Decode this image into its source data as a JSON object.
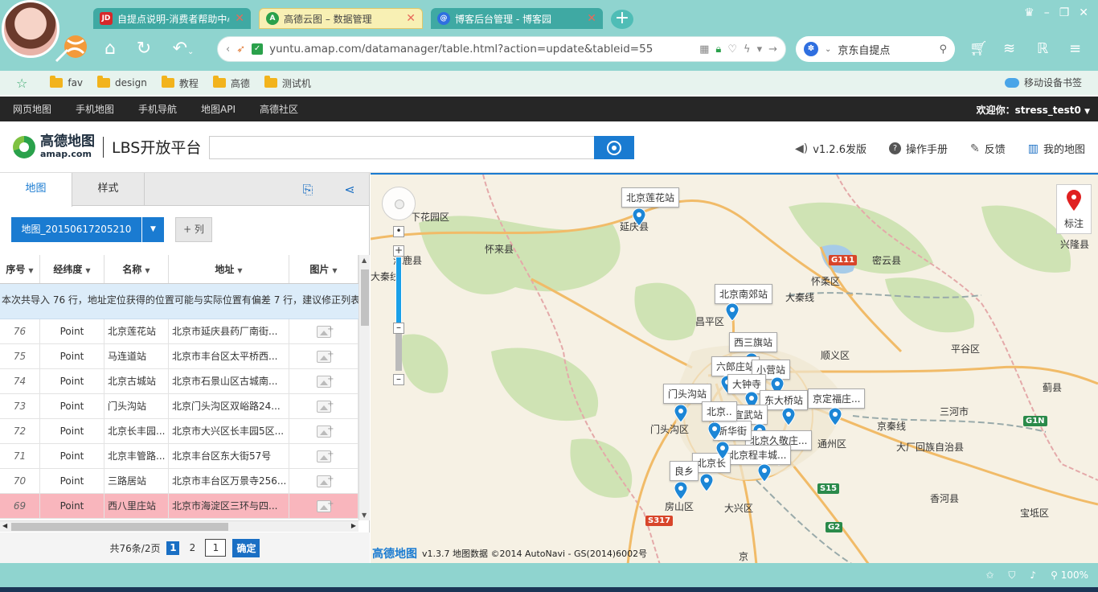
{
  "browser": {
    "tabs": [
      {
        "label": "自提点说明-消费者帮助中心",
        "favicon": "JD",
        "color": "#d7282a"
      },
      {
        "label": "高德云图 – 数据管理",
        "favicon": "A",
        "color": "#2aa14b"
      },
      {
        "label": "博客后台管理 - 博客园",
        "favicon": "@",
        "color": "#2f6fe0"
      }
    ],
    "url": "yuntu.amap.com/datamanager/table.html?action=update&tableid=55",
    "search_engine_text": "京东自提点",
    "bookmarks": [
      "fav",
      "design",
      "教程",
      "高德",
      "测试机"
    ],
    "mobile_bookmark": "移动设备书签",
    "zoom": "100%"
  },
  "sitenav": {
    "items": [
      "网页地图",
      "手机地图",
      "手机导航",
      "地图API",
      "高德社区"
    ],
    "welcome": "欢迎你：stress_test0"
  },
  "header": {
    "logo_cn": "高德地图",
    "logo_en": "amap.com",
    "lbs": "LBS开放平台",
    "search_placeholder": "",
    "links": [
      {
        "label": "v1.2.6发版",
        "icon": "speaker-icon"
      },
      {
        "label": "操作手册",
        "icon": "help-icon"
      },
      {
        "label": "反馈",
        "icon": "edit-icon"
      },
      {
        "label": "我的地图",
        "icon": "map-icon"
      }
    ]
  },
  "panel": {
    "tabs": [
      "地图",
      "样式"
    ],
    "map_select": "地图_20150617205210",
    "column_button": "+ 列",
    "columns": [
      "序号",
      "经纬度",
      "名称",
      "地址",
      "图片"
    ],
    "notice": "本次共导入 76 行，地址定位获得的位置可能与实际位置有偏差 7 行，建议修正列表",
    "rows": [
      {
        "id": "76",
        "geo": "Point",
        "name": "北京莲花站",
        "addr": "北京市延庆县药厂南街..."
      },
      {
        "id": "75",
        "geo": "Point",
        "name": "马连道站",
        "addr": "北京市丰台区太平桥西..."
      },
      {
        "id": "74",
        "geo": "Point",
        "name": "北京古城站",
        "addr": "北京市石景山区古城南..."
      },
      {
        "id": "73",
        "geo": "Point",
        "name": "门头沟站",
        "addr": "北京门头沟区双峪路24..."
      },
      {
        "id": "72",
        "geo": "Point",
        "name": "北京长丰园...",
        "addr": "北京市大兴区长丰园5区..."
      },
      {
        "id": "71",
        "geo": "Point",
        "name": "北京丰管路...",
        "addr": "北京丰台区东大街57号"
      },
      {
        "id": "70",
        "geo": "Point",
        "name": "三路居站",
        "addr": "北京市丰台区万景寺256..."
      },
      {
        "id": "69",
        "geo": "Point",
        "name": "西八里庄站",
        "addr": "北京市海淀区三环与四..."
      }
    ],
    "selected_row_index": 7,
    "pager": {
      "summary": "共76条/2页",
      "pages": [
        "1",
        "2"
      ],
      "current": "1",
      "input": "1",
      "ok": "确定"
    }
  },
  "map": {
    "places": [
      {
        "label": "下花园区"
      },
      {
        "label": "延庆县"
      },
      {
        "label": "怀来县"
      },
      {
        "label": "涿鹿县"
      },
      {
        "label": "大秦线"
      },
      {
        "label": "密云县"
      },
      {
        "label": "兴隆县"
      },
      {
        "label": "怀柔区"
      },
      {
        "label": "大秦线"
      },
      {
        "label": "昌平区"
      },
      {
        "label": "顺义区"
      },
      {
        "label": "平谷区"
      },
      {
        "label": "蓟县"
      },
      {
        "label": "三河市"
      },
      {
        "label": "京秦线"
      },
      {
        "label": "大厂回族自治县"
      },
      {
        "label": "通州区"
      },
      {
        "label": "门头沟区"
      },
      {
        "label": "房山区"
      },
      {
        "label": "大兴区"
      },
      {
        "label": "香河县"
      },
      {
        "label": "宝坻区"
      },
      {
        "label": "良乡"
      },
      {
        "label": "京"
      }
    ],
    "markers": [
      "北京莲花站",
      "北京南郊站",
      "西三旗站",
      "六郎庄站",
      "小营站",
      "大钟寺",
      "门头沟站",
      "东大桥站",
      "京定福庄...",
      "宣武站",
      "北京久敬庄...",
      "北京程丰城...",
      "北京长",
      "新华街",
      "北京..",
      "良乡"
    ],
    "shields": [
      {
        "label": "G111",
        "color": "#d8452a"
      },
      {
        "label": "G1N",
        "color": "#2a8a4a"
      },
      {
        "label": "S15",
        "color": "#2a8a4a"
      },
      {
        "label": "G2",
        "color": "#2a8a4a"
      },
      {
        "label": "S317",
        "color": "#d8452a"
      }
    ],
    "pin_control_label": "标注",
    "footer": {
      "logo": "高德地图",
      "text": "v1.3.7 地图数据 ©2014 AutoNavi - GS(2014)6002号"
    }
  }
}
